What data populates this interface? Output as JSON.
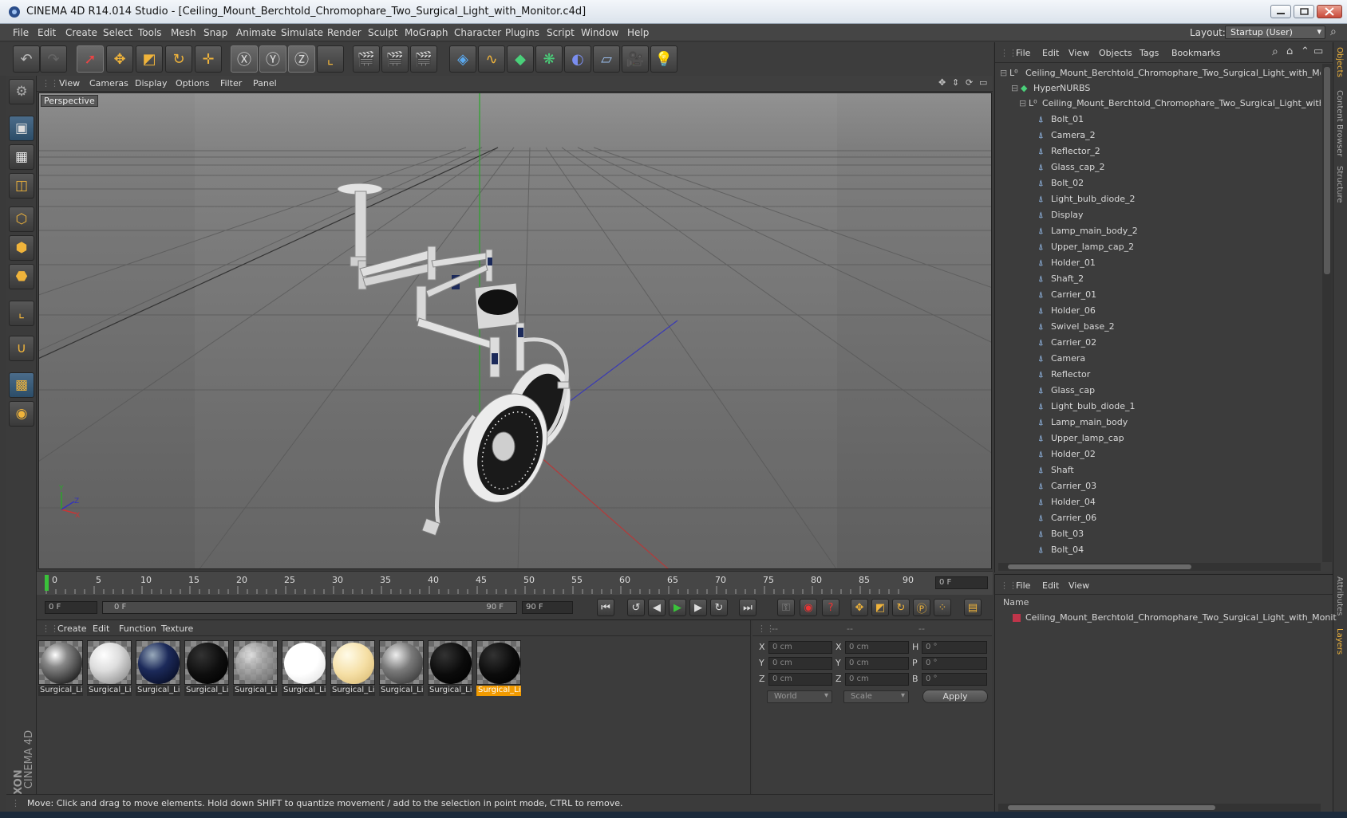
{
  "window": {
    "title": "CINEMA 4D R14.014 Studio - [Ceiling_Mount_Berchtold_Chromophare_Two_Surgical_Light_with_Monitor.c4d]"
  },
  "menubar": {
    "items": [
      "File",
      "Edit",
      "Create",
      "Select",
      "Tools",
      "Mesh",
      "Snap",
      "Animate",
      "Simulate",
      "Render",
      "Sculpt",
      "MoGraph",
      "Character",
      "Plugins",
      "Script",
      "Window",
      "Help"
    ],
    "layout_label": "Layout:",
    "layout_value": "Startup (User)"
  },
  "viewport": {
    "menu": [
      "View",
      "Cameras",
      "Display",
      "Options",
      "Filter",
      "Panel"
    ],
    "label": "Perspective"
  },
  "timeline": {
    "ticks": [
      "0",
      "5",
      "10",
      "15",
      "20",
      "25",
      "30",
      "35",
      "40",
      "45",
      "50",
      "55",
      "60",
      "65",
      "70",
      "75",
      "80",
      "85",
      "90"
    ],
    "current_frame": "0 F",
    "start_field": "0 F",
    "range_start": "0 F",
    "range_end": "90 F",
    "end_field": "90 F"
  },
  "materials": {
    "menu": [
      "Create",
      "Edit",
      "Function",
      "Texture"
    ],
    "items": [
      {
        "label": "Surgical_Li",
        "color": "#9a9a9a"
      },
      {
        "label": "Surgical_Li",
        "color": "#e0e0e0"
      },
      {
        "label": "Surgical_Li",
        "color": "#1c2a5a"
      },
      {
        "label": "Surgical_Li",
        "color": "#0e0e0e"
      },
      {
        "label": "Surgical_Li",
        "color": "#b8b8b8"
      },
      {
        "label": "Surgical_Li",
        "color": "#ffffff"
      },
      {
        "label": "Surgical_Li",
        "color": "#f5dfa5"
      },
      {
        "label": "Surgical_Li",
        "color": "#7a7a7a"
      },
      {
        "label": "Surgical_Li",
        "color": "#0b0b0b"
      },
      {
        "label": "Surgical_Li",
        "color": "#0b0b0b"
      }
    ],
    "selected_index": 9
  },
  "attributes": {
    "header": [
      "--",
      "--",
      "--"
    ],
    "rows": [
      {
        "a": "X",
        "av": "0 cm",
        "b": "X",
        "bv": "0 cm",
        "c": "H",
        "cv": "0 °"
      },
      {
        "a": "Y",
        "av": "0 cm",
        "b": "Y",
        "bv": "0 cm",
        "c": "P",
        "cv": "0 °"
      },
      {
        "a": "Z",
        "av": "0 cm",
        "b": "Z",
        "bv": "0 cm",
        "c": "B",
        "cv": "0 °"
      }
    ],
    "world": "World",
    "scale": "Scale",
    "apply": "Apply"
  },
  "status": "Move: Click and drag to move elements. Hold down SHIFT to quantize movement / add to the selection in point mode, CTRL to remove.",
  "objects": {
    "menu": [
      "File",
      "Edit",
      "View",
      "Objects",
      "Tags",
      "Bookmarks"
    ],
    "root": "Ceiling_Mount_Berchtold_Chromophare_Two_Surgical_Light_with_Mon",
    "nurbs": "HyperNURBS",
    "group": "Ceiling_Mount_Berchtold_Chromophare_Two_Surgical_Light_with_",
    "items": [
      "Bolt_01",
      "Camera_2",
      "Reflector_2",
      "Glass_cap_2",
      "Bolt_02",
      "Light_bulb_diode_2",
      "Display",
      "Lamp_main_body_2",
      "Upper_lamp_cap_2",
      "Holder_01",
      "Shaft_2",
      "Carrier_01",
      "Holder_06",
      "Swivel_base_2",
      "Carrier_02",
      "Camera",
      "Reflector",
      "Glass_cap",
      "Light_bulb_diode_1",
      "Lamp_main_body",
      "Upper_lamp_cap",
      "Holder_02",
      "Shaft",
      "Carrier_03",
      "Holder_04",
      "Carrier_06",
      "Bolt_03",
      "Bolt_04"
    ]
  },
  "sidetabs": [
    "Objects",
    "Content Browser",
    "Structure",
    "Attributes",
    "Layers"
  ],
  "layers": {
    "menu": [
      "File",
      "Edit",
      "View"
    ],
    "name_header": "Name",
    "item": "Ceiling_Mount_Berchtold_Chromophare_Two_Surgical_Light_with_Monit"
  },
  "logo": {
    "text1": "MAXON",
    "text2": "CINEMA 4D"
  },
  "colors": {
    "accent": "#f19a00",
    "selected": "#f19a00"
  }
}
